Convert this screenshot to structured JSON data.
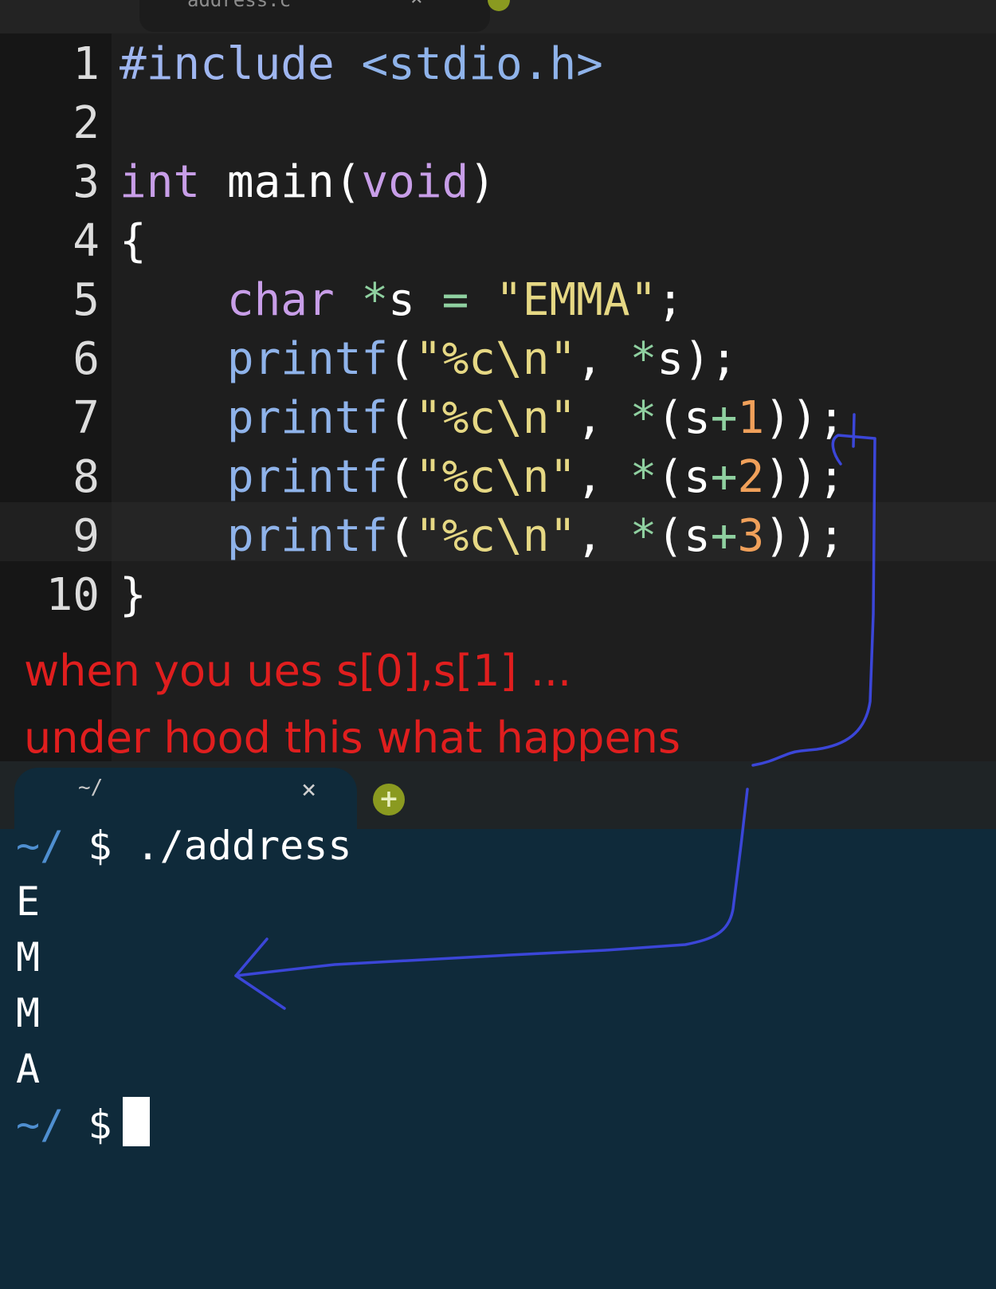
{
  "editor": {
    "tab_title": "address.c",
    "tab_close": "×",
    "lines": [
      {
        "n": "1",
        "tokens": [
          {
            "t": "#include ",
            "c": "pp"
          },
          {
            "t": "<stdio.h>",
            "c": "fn"
          }
        ]
      },
      {
        "n": "2",
        "tokens": []
      },
      {
        "n": "3",
        "tokens": [
          {
            "t": "int",
            "c": "kw"
          },
          {
            "t": " main(",
            "c": "txt"
          },
          {
            "t": "void",
            "c": "kw"
          },
          {
            "t": ")",
            "c": "txt"
          }
        ]
      },
      {
        "n": "4",
        "tokens": [
          {
            "t": "{",
            "c": "txt"
          }
        ]
      },
      {
        "n": "5",
        "tokens": [
          {
            "t": "    ",
            "c": "txt"
          },
          {
            "t": "char",
            "c": "kw"
          },
          {
            "t": " ",
            "c": "txt"
          },
          {
            "t": "*",
            "c": "op"
          },
          {
            "t": "s ",
            "c": "txt"
          },
          {
            "t": "=",
            "c": "op"
          },
          {
            "t": " ",
            "c": "txt"
          },
          {
            "t": "\"EMMA\"",
            "c": "str"
          },
          {
            "t": ";",
            "c": "txt"
          }
        ]
      },
      {
        "n": "6",
        "tokens": [
          {
            "t": "    ",
            "c": "txt"
          },
          {
            "t": "printf",
            "c": "fn"
          },
          {
            "t": "(",
            "c": "txt"
          },
          {
            "t": "\"%c\\n\"",
            "c": "str"
          },
          {
            "t": ", ",
            "c": "txt"
          },
          {
            "t": "*",
            "c": "op"
          },
          {
            "t": "s);",
            "c": "txt"
          }
        ]
      },
      {
        "n": "7",
        "tokens": [
          {
            "t": "    ",
            "c": "txt"
          },
          {
            "t": "printf",
            "c": "fn"
          },
          {
            "t": "(",
            "c": "txt"
          },
          {
            "t": "\"%c\\n\"",
            "c": "str"
          },
          {
            "t": ", ",
            "c": "txt"
          },
          {
            "t": "*",
            "c": "op"
          },
          {
            "t": "(s",
            "c": "txt"
          },
          {
            "t": "+",
            "c": "op"
          },
          {
            "t": "1",
            "c": "num"
          },
          {
            "t": "));",
            "c": "txt"
          }
        ]
      },
      {
        "n": "8",
        "tokens": [
          {
            "t": "    ",
            "c": "txt"
          },
          {
            "t": "printf",
            "c": "fn"
          },
          {
            "t": "(",
            "c": "txt"
          },
          {
            "t": "\"%c\\n\"",
            "c": "str"
          },
          {
            "t": ", ",
            "c": "txt"
          },
          {
            "t": "*",
            "c": "op"
          },
          {
            "t": "(s",
            "c": "txt"
          },
          {
            "t": "+",
            "c": "op"
          },
          {
            "t": "2",
            "c": "num"
          },
          {
            "t": "));",
            "c": "txt"
          }
        ]
      },
      {
        "n": "9",
        "tokens": [
          {
            "t": "    ",
            "c": "txt"
          },
          {
            "t": "printf",
            "c": "fn"
          },
          {
            "t": "(",
            "c": "txt"
          },
          {
            "t": "\"%c\\n\"",
            "c": "str"
          },
          {
            "t": ", ",
            "c": "txt"
          },
          {
            "t": "*",
            "c": "op"
          },
          {
            "t": "(s",
            "c": "txt"
          },
          {
            "t": "+",
            "c": "op"
          },
          {
            "t": "3",
            "c": "num"
          },
          {
            "t": "));",
            "c": "txt"
          }
        ]
      },
      {
        "n": "10",
        "tokens": [
          {
            "t": "}",
            "c": "txt"
          }
        ]
      }
    ]
  },
  "annotation": {
    "line1": "when you ues s[0],s[1] ...",
    "line2": "under hood this what happens",
    "text_color": "#e01e1e",
    "arrow_color": "#3b46d8"
  },
  "terminal": {
    "tab_title": "~/",
    "tab_close": "×",
    "add_tab": "+",
    "prompt_dir": "~/",
    "prompt_sign": "$",
    "command": "./address",
    "output": [
      "E",
      "M",
      "M",
      "A"
    ]
  }
}
